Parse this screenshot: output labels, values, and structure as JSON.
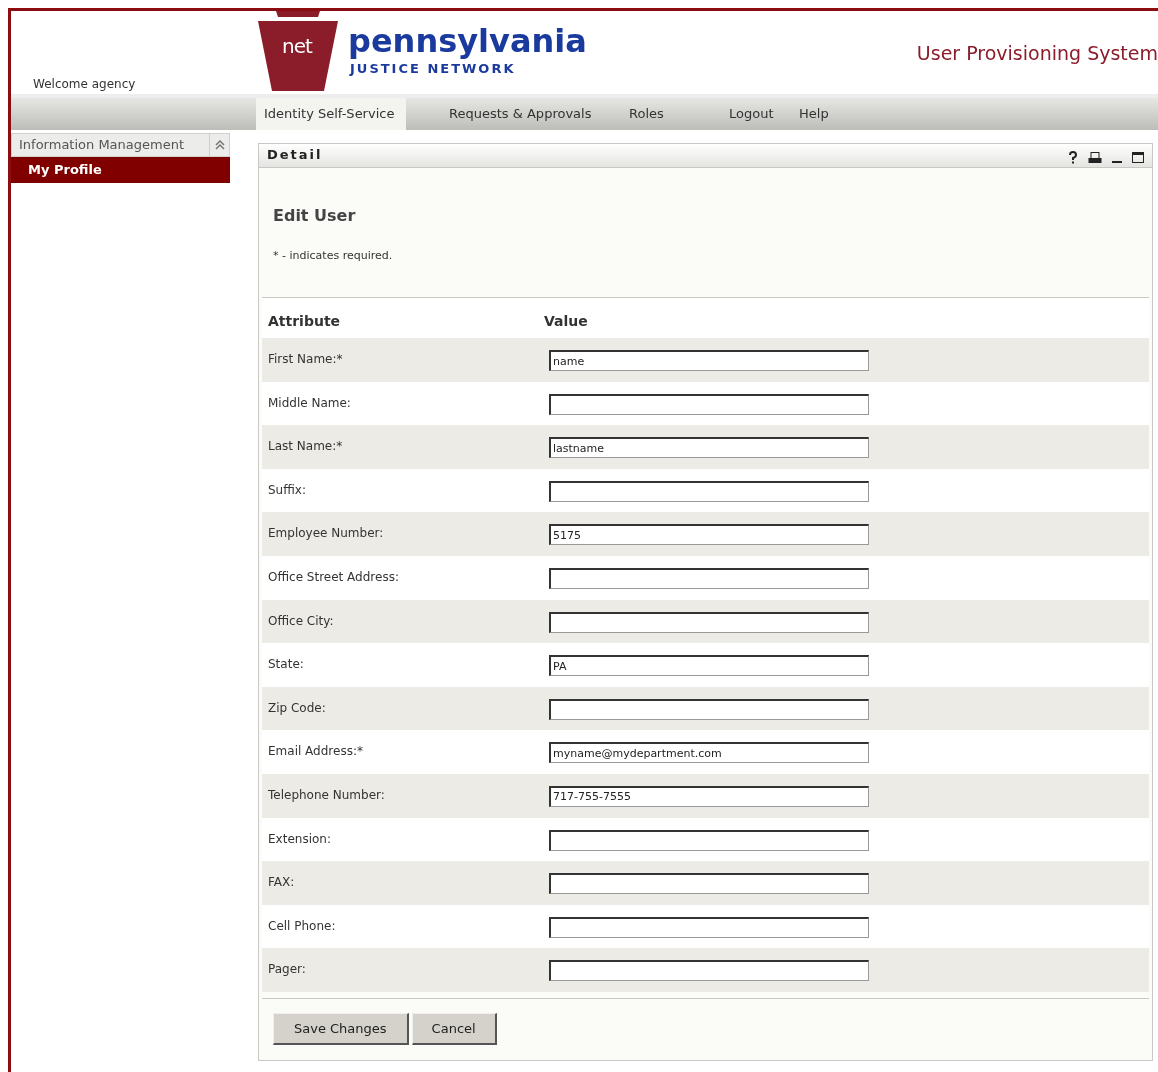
{
  "header": {
    "welcome": "Welcome agency",
    "logo_mark": "net",
    "logo_name": "pennsylvania",
    "logo_tagline": "JUSTICE NETWORK",
    "system_title": "User Provisioning System"
  },
  "nav": [
    {
      "label": "Identity Self-Service",
      "selected": true
    },
    {
      "label": "Requests & Approvals",
      "selected": false
    },
    {
      "label": "Roles",
      "selected": false
    },
    {
      "label": "Logout",
      "selected": false
    },
    {
      "label": "Help",
      "selected": false
    }
  ],
  "sidebar": {
    "section": "Information Management",
    "expanded": true,
    "items": [
      {
        "label": "My Profile",
        "selected": true
      }
    ]
  },
  "panel": {
    "title": "Detail",
    "heading": "Edit User",
    "note": "* - indicates required.",
    "columns": [
      "Attribute",
      "Value"
    ],
    "rows": [
      {
        "label": "First Name:*",
        "value": "name"
      },
      {
        "label": "Middle Name:"
      },
      {
        "label": "Last Name:*",
        "value": "lastname"
      },
      {
        "label": "Suffix:"
      },
      {
        "label": "Employee Number:",
        "value": "5175"
      },
      {
        "label": "Office Street Address:"
      },
      {
        "label": "Office City:"
      },
      {
        "label": "State:",
        "value": "PA"
      },
      {
        "label": "Zip Code:"
      },
      {
        "label": "Email Address:*",
        "value": "myname@mydepartment.com"
      },
      {
        "label": "Telephone Number:",
        "value": "717-755-7555"
      },
      {
        "label": "Extension:"
      },
      {
        "label": "FAX:"
      },
      {
        "label": "Cell Phone:"
      },
      {
        "label": "Pager:"
      }
    ],
    "buttons": [
      "Save Changes",
      "Cancel"
    ]
  }
}
